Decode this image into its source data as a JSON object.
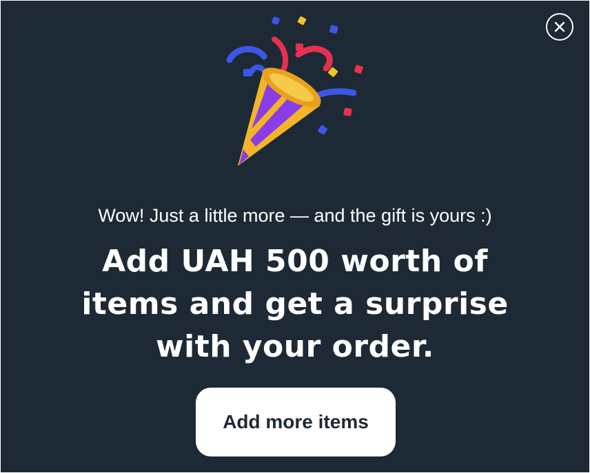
{
  "dialog": {
    "close_icon": "close-icon",
    "illustration_icon": "party-popper-icon",
    "subtitle": "Wow! Just a little more — and the gift is yours :)",
    "headline": "Add UAH 500 worth of items and get a surprise with your order.",
    "cta_label": "Add more items"
  },
  "colors": {
    "background": "#1d2a35",
    "button_bg": "#ffffff",
    "button_text": "#1d2a35",
    "text": "#ffffff"
  }
}
